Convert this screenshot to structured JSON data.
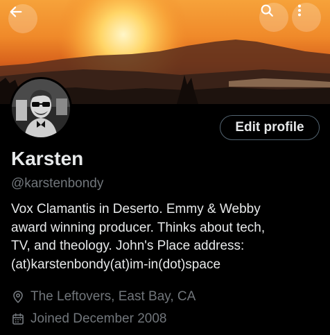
{
  "header": {
    "back_icon": "arrow-left-icon",
    "search_icon": "search-icon",
    "more_icon": "more-vertical-icon"
  },
  "profile": {
    "name": "Karsten",
    "handle": "@karstenbondy",
    "edit_label": "Edit profile",
    "bio_lines": [
      "Vox Clamantis in Deserto. Emmy & Webby",
      "award winning producer. Thinks about tech,",
      "TV, and theology. John's Place address:",
      "(at)karstenbondy(at)im-in(dot)space"
    ],
    "location": "The Leftovers, East Bay, CA",
    "joined": "Joined December 2008"
  },
  "colors": {
    "background": "#000000",
    "text": "#e7e9ea",
    "muted": "#71767b",
    "border": "#536471"
  }
}
